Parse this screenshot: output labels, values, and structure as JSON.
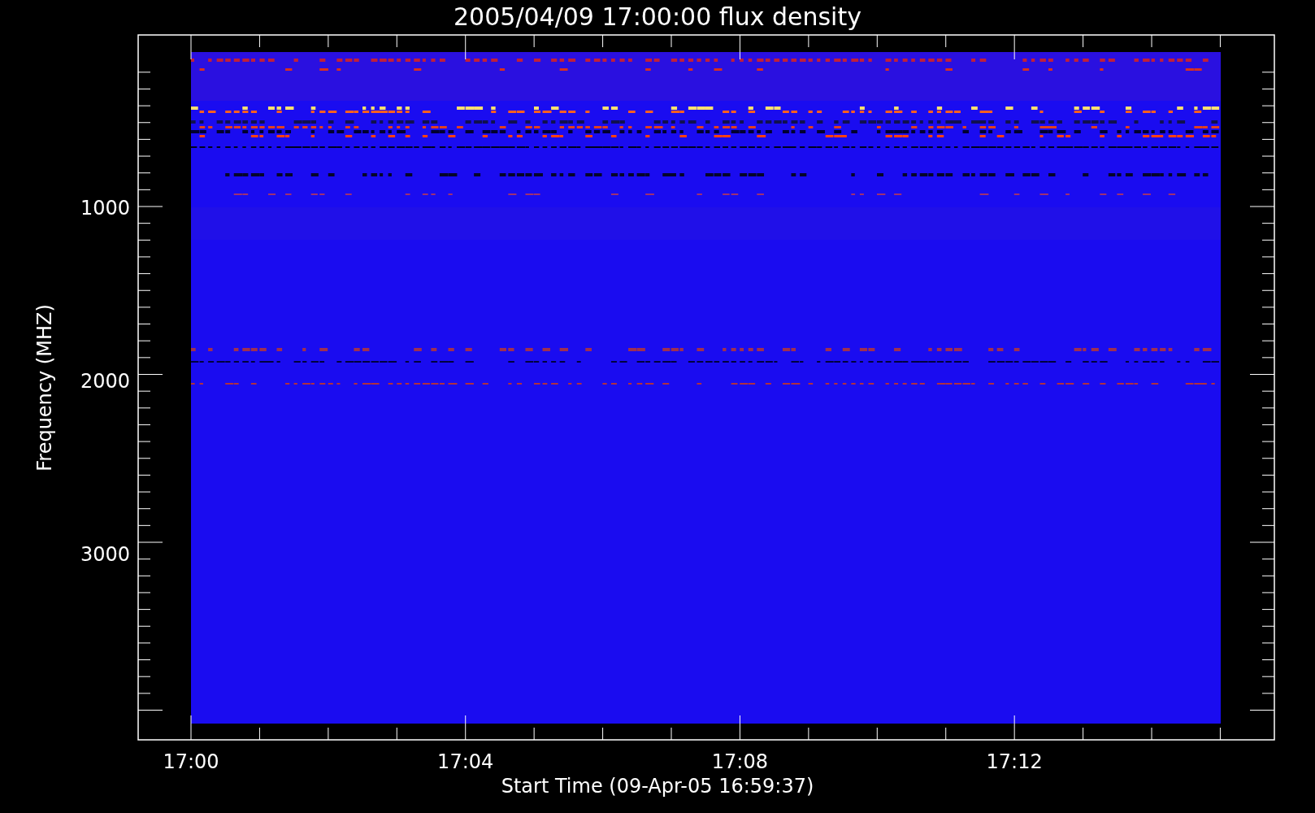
{
  "title": "2005/04/09 17:00:00 flux density",
  "y_axis": {
    "label": "Frequency (MHZ)",
    "ticks": [
      "1000",
      "2000",
      "3000"
    ]
  },
  "x_axis": {
    "label": "Start Time (09-Apr-05 16:59:37)",
    "ticks": [
      "17:00",
      "17:04",
      "17:08",
      "17:12"
    ]
  }
}
